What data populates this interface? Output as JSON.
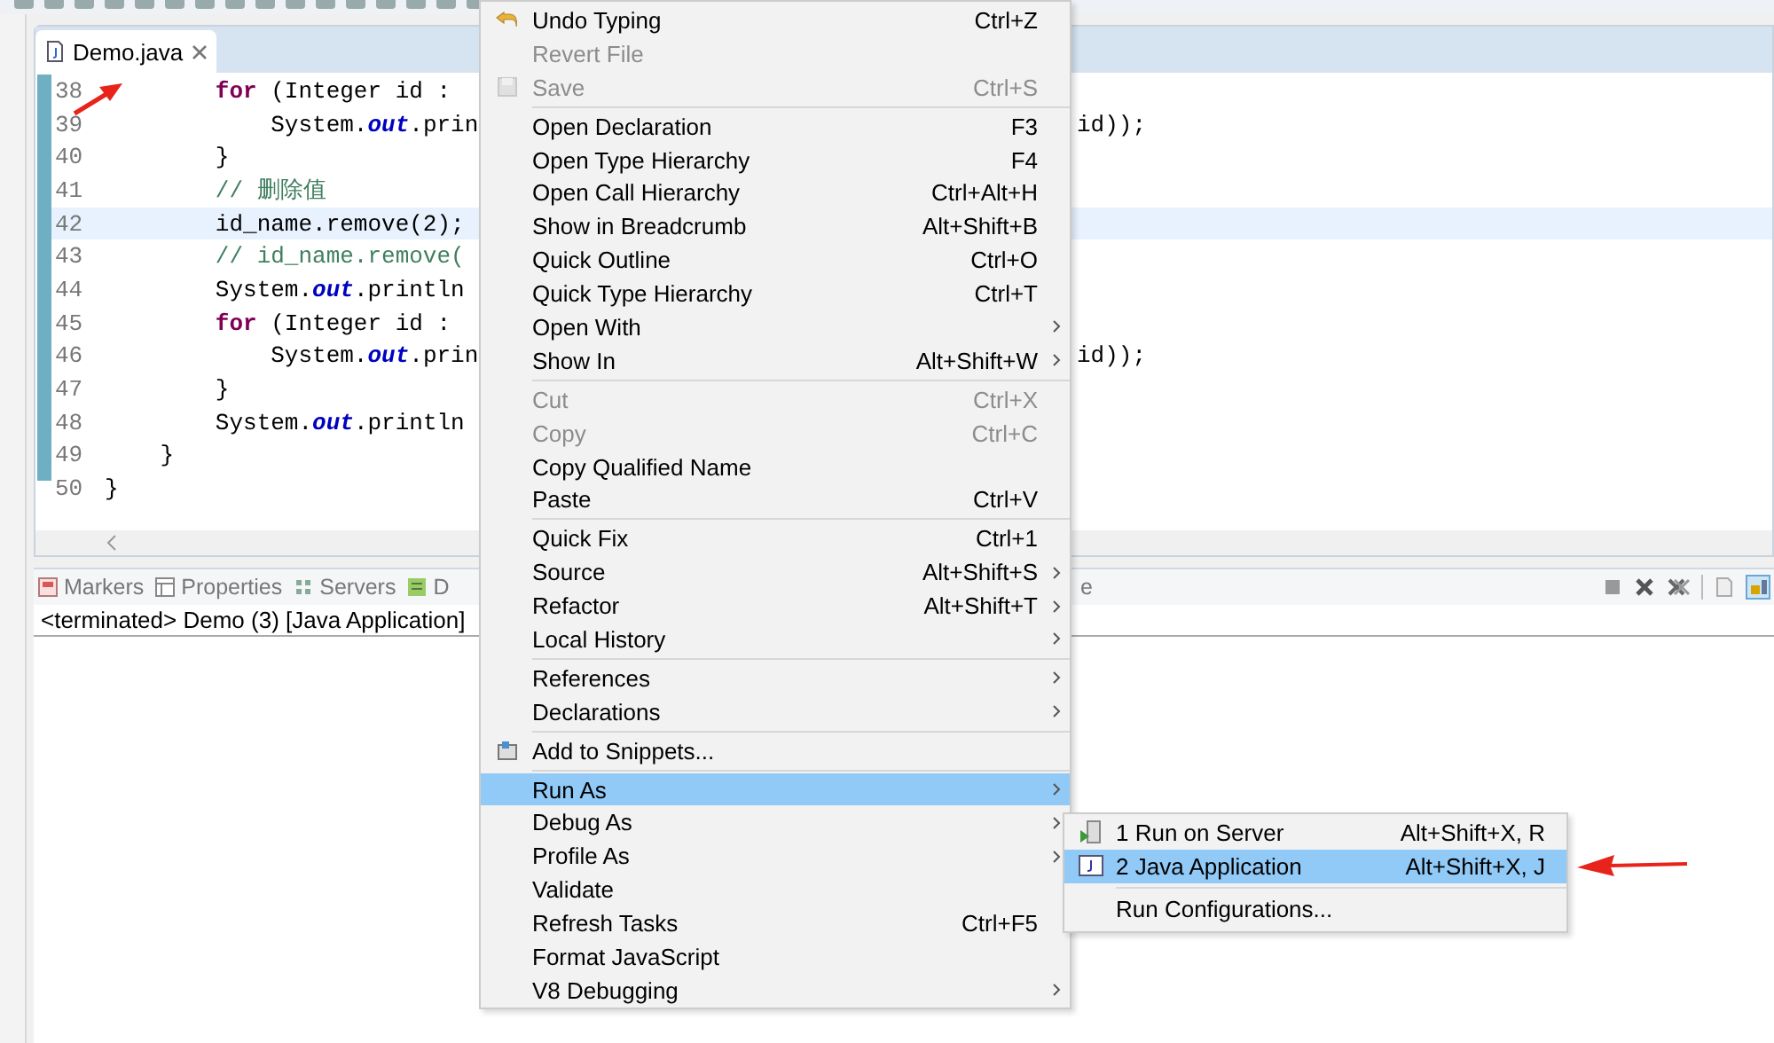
{
  "editor": {
    "tab": {
      "label": "Demo.java",
      "selected": true
    },
    "lines": [
      {
        "number": "38",
        "current": false,
        "tokens": [
          {
            "text": "        for",
            "kind": "keyword"
          },
          {
            "text": " (Integer id :",
            "kind": "plain"
          }
        ]
      },
      {
        "number": "39",
        "current": false,
        "tokens": [
          {
            "text": "            System.",
            "kind": "plain"
          },
          {
            "text": "out",
            "kind": "field"
          },
          {
            "text": ".prin",
            "kind": "plain"
          }
        ],
        "right_text": "id));"
      },
      {
        "number": "40",
        "current": false,
        "tokens": [
          {
            "text": "        }",
            "kind": "plain"
          }
        ]
      },
      {
        "number": "41",
        "current": false,
        "tokens": [
          {
            "text": "        // 删除值",
            "kind": "comment"
          }
        ]
      },
      {
        "number": "42",
        "current": true,
        "tokens": [
          {
            "text": "        id_name.remove(2);",
            "kind": "plain"
          }
        ]
      },
      {
        "number": "43",
        "current": false,
        "tokens": [
          {
            "text": "        // id_name.remove(",
            "kind": "comment"
          }
        ]
      },
      {
        "number": "44",
        "current": false,
        "tokens": [
          {
            "text": "        System.",
            "kind": "plain"
          },
          {
            "text": "out",
            "kind": "field"
          },
          {
            "text": ".println",
            "kind": "plain"
          }
        ]
      },
      {
        "number": "45",
        "current": false,
        "tokens": [
          {
            "text": "        for",
            "kind": "keyword"
          },
          {
            "text": " (Integer id :",
            "kind": "plain"
          }
        ]
      },
      {
        "number": "46",
        "current": false,
        "tokens": [
          {
            "text": "            System.",
            "kind": "plain"
          },
          {
            "text": "out",
            "kind": "field"
          },
          {
            "text": ".prin",
            "kind": "plain"
          }
        ],
        "right_text": "id));"
      },
      {
        "number": "47",
        "current": false,
        "tokens": [
          {
            "text": "        }",
            "kind": "plain"
          }
        ]
      },
      {
        "number": "48",
        "current": false,
        "tokens": [
          {
            "text": "        System.",
            "kind": "plain"
          },
          {
            "text": "out",
            "kind": "field"
          },
          {
            "text": ".println",
            "kind": "plain"
          }
        ]
      },
      {
        "number": "49",
        "current": false,
        "tokens": [
          {
            "text": "    }",
            "kind": "plain"
          }
        ]
      },
      {
        "number": "50",
        "current": false,
        "tokens": [
          {
            "text": "}",
            "kind": "plain"
          }
        ]
      }
    ]
  },
  "panel": {
    "tabs": [
      {
        "label": "Markers",
        "kind": "markers",
        "selected": false
      },
      {
        "label": "Properties",
        "kind": "properties",
        "selected": false
      },
      {
        "label": "Servers",
        "kind": "servers",
        "selected": false
      },
      {
        "label": "D",
        "kind": "data",
        "selected": false
      }
    ],
    "tail_text": "e",
    "console": "<terminated> Demo (3) [Java Application]"
  },
  "context_menu": {
    "groups": [
      [
        {
          "label": "Undo Typing",
          "shortcut": "Ctrl+Z",
          "kind": "undo",
          "disabled": false,
          "submenu": false,
          "selected": false
        },
        {
          "label": "Revert File",
          "disabled": true,
          "submenu": false,
          "selected": false
        },
        {
          "label": "Save",
          "shortcut": "Ctrl+S",
          "kind": "save",
          "disabled": true,
          "submenu": false,
          "selected": false
        }
      ],
      [
        {
          "label": "Open Declaration",
          "shortcut": "F3",
          "disabled": false,
          "submenu": false,
          "selected": false
        },
        {
          "label": "Open Type Hierarchy",
          "shortcut": "F4",
          "disabled": false,
          "submenu": false,
          "selected": false
        },
        {
          "label": "Open Call Hierarchy",
          "shortcut": "Ctrl+Alt+H",
          "disabled": false,
          "submenu": false,
          "selected": false
        },
        {
          "label": "Show in Breadcrumb",
          "shortcut": "Alt+Shift+B",
          "disabled": false,
          "submenu": false,
          "selected": false
        },
        {
          "label": "Quick Outline",
          "shortcut": "Ctrl+O",
          "disabled": false,
          "submenu": false,
          "selected": false
        },
        {
          "label": "Quick Type Hierarchy",
          "shortcut": "Ctrl+T",
          "disabled": false,
          "submenu": false,
          "selected": false
        },
        {
          "label": "Open With",
          "disabled": false,
          "submenu": true,
          "selected": false
        },
        {
          "label": "Show In",
          "shortcut": "Alt+Shift+W",
          "disabled": false,
          "submenu": true,
          "selected": false
        }
      ],
      [
        {
          "label": "Cut",
          "shortcut": "Ctrl+X",
          "disabled": true,
          "submenu": false,
          "selected": false
        },
        {
          "label": "Copy",
          "shortcut": "Ctrl+C",
          "disabled": true,
          "submenu": false,
          "selected": false
        },
        {
          "label": "Copy Qualified Name",
          "disabled": false,
          "submenu": false,
          "selected": false
        },
        {
          "label": "Paste",
          "shortcut": "Ctrl+V",
          "disabled": false,
          "submenu": false,
          "selected": false
        }
      ],
      [
        {
          "label": "Quick Fix",
          "shortcut": "Ctrl+1",
          "disabled": false,
          "submenu": false,
          "selected": false
        },
        {
          "label": "Source",
          "shortcut": "Alt+Shift+S",
          "disabled": false,
          "submenu": true,
          "selected": false
        },
        {
          "label": "Refactor",
          "shortcut": "Alt+Shift+T",
          "disabled": false,
          "submenu": true,
          "selected": false
        },
        {
          "label": "Local History",
          "disabled": false,
          "submenu": true,
          "selected": false
        }
      ],
      [
        {
          "label": "References",
          "disabled": false,
          "submenu": true,
          "selected": false
        },
        {
          "label": "Declarations",
          "disabled": false,
          "submenu": true,
          "selected": false
        }
      ],
      [
        {
          "label": "Add to Snippets...",
          "kind": "snippets",
          "disabled": false,
          "submenu": false,
          "selected": false
        }
      ],
      [
        {
          "label": "Run As",
          "disabled": false,
          "submenu": true,
          "selected": true
        },
        {
          "label": "Debug As",
          "disabled": false,
          "submenu": true,
          "selected": false
        },
        {
          "label": "Profile As",
          "disabled": false,
          "submenu": true,
          "selected": false
        },
        {
          "label": "Validate",
          "disabled": false,
          "submenu": false,
          "selected": false
        },
        {
          "label": "Refresh Tasks",
          "shortcut": "Ctrl+F5",
          "disabled": false,
          "submenu": false,
          "selected": false
        },
        {
          "label": "Format JavaScript",
          "disabled": false,
          "submenu": false,
          "selected": false
        },
        {
          "label": "V8 Debugging",
          "disabled": false,
          "submenu": true,
          "selected": false
        }
      ]
    ]
  },
  "run_as_submenu": {
    "groups": [
      [
        {
          "label": "1 Run on Server",
          "shortcut": "Alt+Shift+X, R",
          "kind": "server",
          "selected": false
        },
        {
          "label": "2 Java Application",
          "shortcut": "Alt+Shift+X, J",
          "kind": "java",
          "selected": true
        }
      ],
      [
        {
          "label": "Run Configurations...",
          "selected": false
        }
      ]
    ]
  }
}
